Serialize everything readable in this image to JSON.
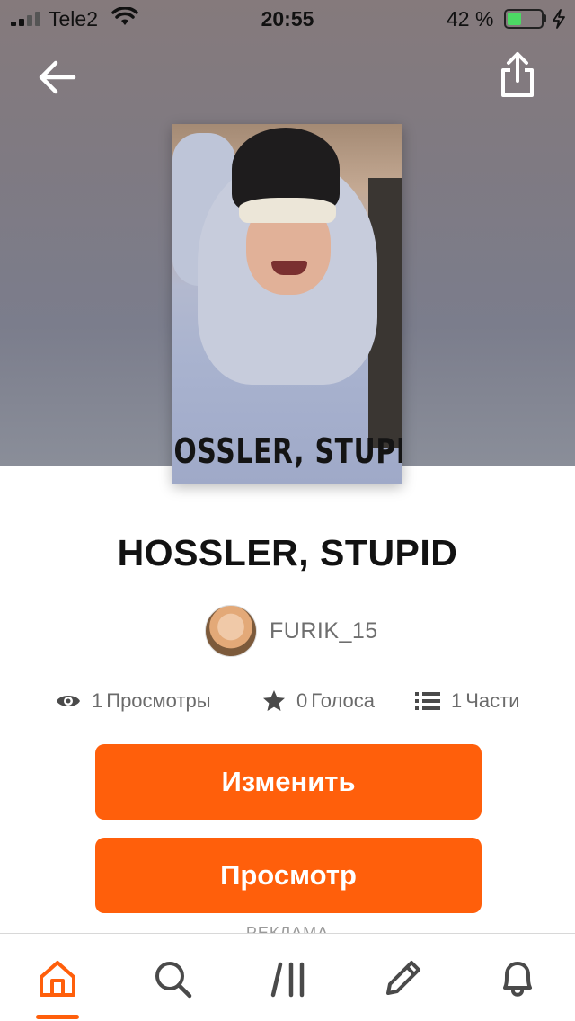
{
  "status_bar": {
    "carrier": "Tele2",
    "time": "20:55",
    "battery_percent": "42 %",
    "battery_level": 0.42,
    "signal_icon": "cellular-signal-icon",
    "wifi_icon": "wifi-icon",
    "charging_icon": "charging-bolt-icon"
  },
  "header": {
    "back_icon": "arrow-left-icon",
    "share_icon": "share-icon"
  },
  "cover": {
    "title_text": "OSSLER, STUPID"
  },
  "story": {
    "title": "HOSSLER, STUPID",
    "author": "FURIK_15"
  },
  "stats": {
    "reads": {
      "icon": "eye-icon",
      "count": "1",
      "label": "Просмотры"
    },
    "votes": {
      "icon": "star-icon",
      "count": "0",
      "label": "Голоса"
    },
    "parts": {
      "icon": "list-icon",
      "count": "1",
      "label": "Части"
    }
  },
  "actions": {
    "edit_label": "Изменить",
    "view_label": "Просмотр"
  },
  "ad": {
    "label": "РЕКЛАМА"
  },
  "tab_bar": {
    "items": [
      {
        "name": "home",
        "icon": "home-icon",
        "active": true
      },
      {
        "name": "search",
        "icon": "search-icon",
        "active": false
      },
      {
        "name": "library",
        "icon": "library-icon",
        "active": false
      },
      {
        "name": "write",
        "icon": "pencil-icon",
        "active": false
      },
      {
        "name": "notifications",
        "icon": "bell-icon",
        "active": false
      }
    ]
  },
  "colors": {
    "accent": "#ff5f0b",
    "battery_green": "#4cd964",
    "text_muted": "#6b6b6b",
    "icon_gray": "#4a4a4a"
  }
}
